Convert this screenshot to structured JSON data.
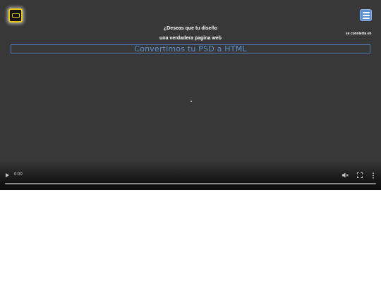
{
  "logo": {
    "icon": "logo-icon"
  },
  "menu": {
    "icon": "hamburger-menu-icon"
  },
  "hero": {
    "line1": "¿Deseas que tu diseño",
    "line2": "se convierta en",
    "line3": "una verdadera pagina web",
    "headline": "Convertimos tu PSD a HTML"
  },
  "video": {
    "time": "0:00",
    "progress_fraction": 0,
    "icons": [
      "play-icon",
      "mute-icon",
      "fullscreen-icon",
      "more-options-icon"
    ]
  },
  "colors": {
    "background": "#383838",
    "accent": "#5b8fd4",
    "logo_border": "#e6c619"
  }
}
